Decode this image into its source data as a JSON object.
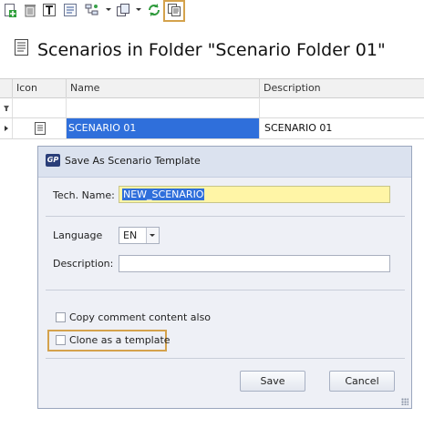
{
  "toolbar": {
    "icons": [
      "add-icon",
      "delete-icon",
      "text-icon",
      "properties-icon",
      "tree-icon",
      "copy-icon",
      "refresh-icon",
      "save-as-template-icon"
    ]
  },
  "page": {
    "title": "Scenarios in Folder \"Scenario Folder 01\""
  },
  "grid": {
    "columns": [
      "Icon",
      "Name",
      "Description"
    ],
    "rows": [
      {
        "name": "SCENARIO 01",
        "description": "SCENARIO 01"
      }
    ]
  },
  "dialog": {
    "title": "Save As Scenario Template",
    "logo_text": "GP",
    "tech_name_label": "Tech. Name:",
    "tech_name_value": "NEW_SCENARIO",
    "language_label": "Language",
    "language_value": "EN",
    "description_label": "Description:",
    "description_value": "",
    "copy_comment_label": "Copy comment content also",
    "copy_comment_checked": false,
    "clone_template_label": "Clone as a template",
    "clone_template_checked": false,
    "save_label": "Save",
    "cancel_label": "Cancel"
  },
  "colors": {
    "highlight_border": "#d4a24c",
    "selection": "#2f6fdb",
    "required_field": "#fff5a6"
  }
}
